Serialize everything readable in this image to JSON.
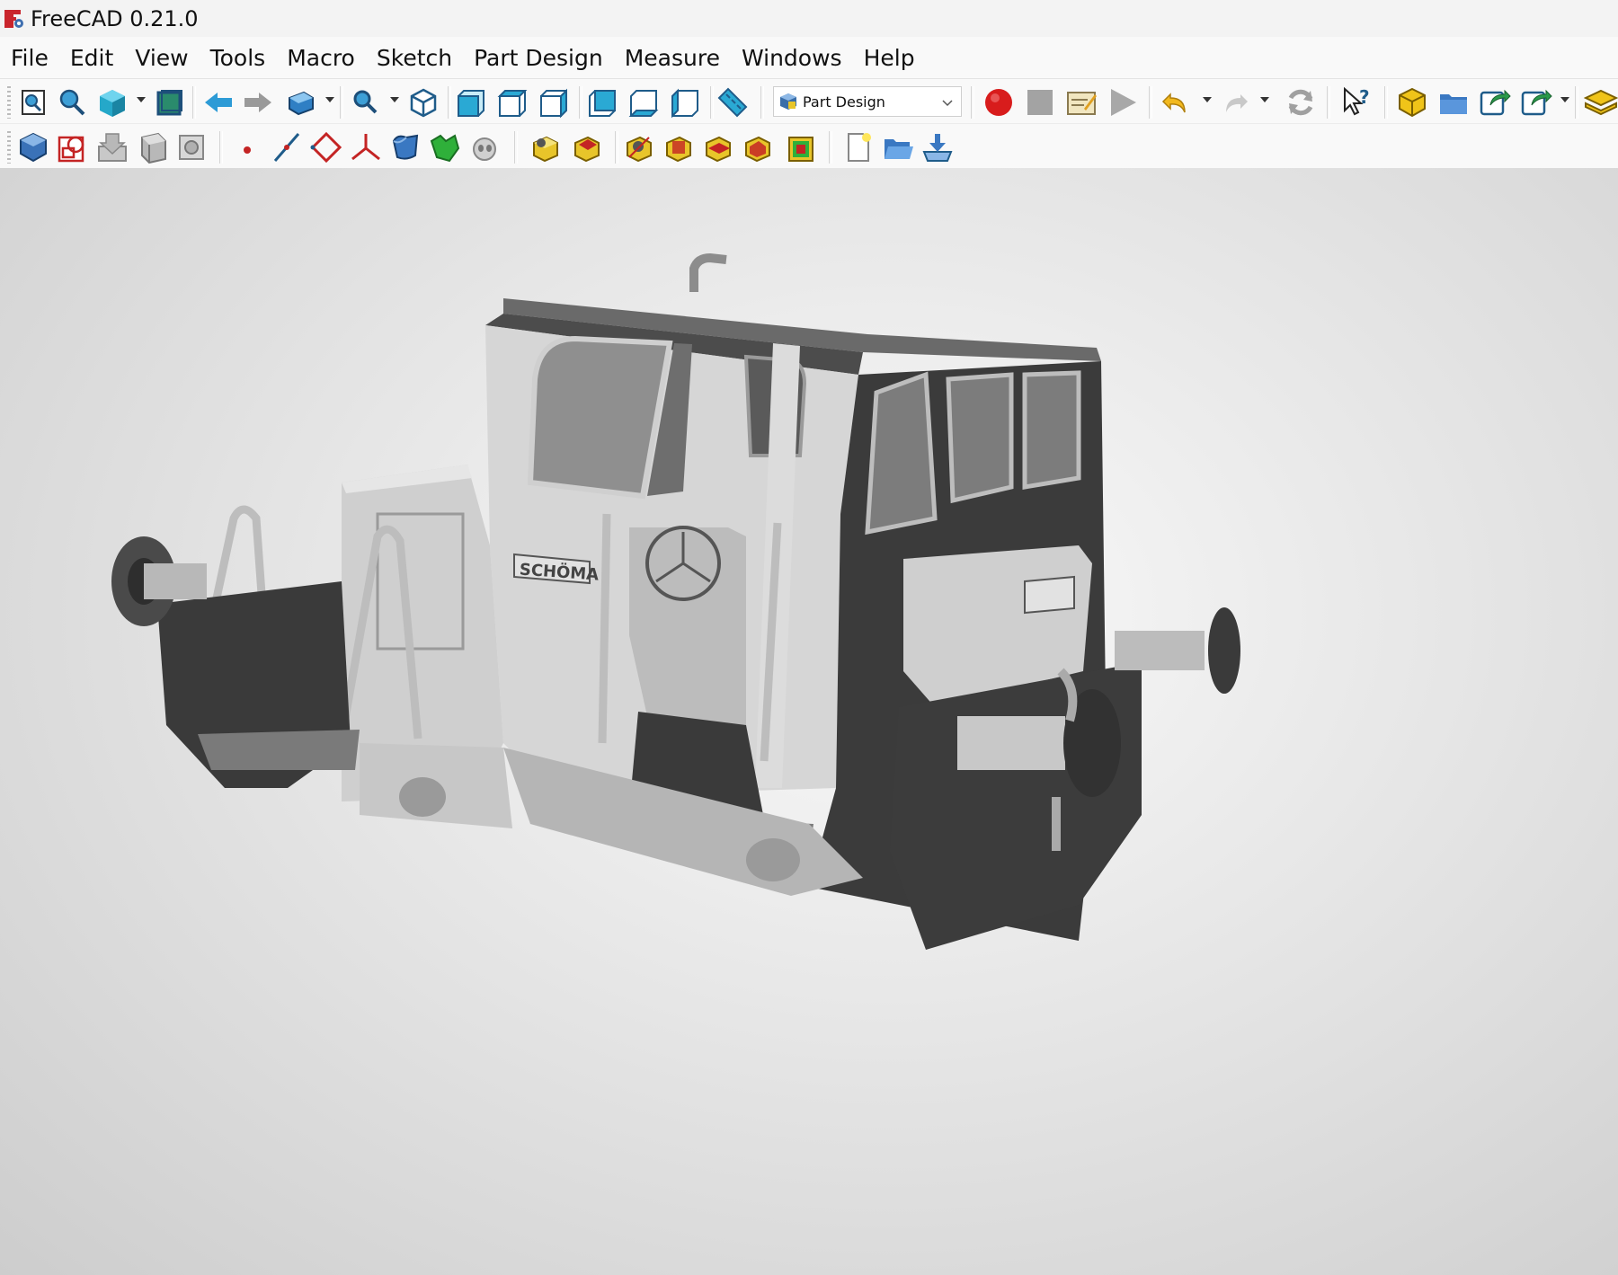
{
  "window": {
    "title": "FreeCAD 0.21.0",
    "logo_icon": "freecad-logo-icon"
  },
  "menu": [
    "File",
    "Edit",
    "View",
    "Tools",
    "Macro",
    "Sketch",
    "Part Design",
    "Measure",
    "Windows",
    "Help"
  ],
  "workbench_selector": {
    "value": "Part Design",
    "icon": "part-design-workbench-icon"
  },
  "toolbar_row1_icons": [
    "fit-all-icon",
    "fit-selection-icon",
    "std-view-menu-icon",
    "bounding-box-icon",
    "back-arrow-icon",
    "forward-arrow-icon",
    "draw-style-icon",
    "zoom-menu-icon",
    "isometric-view-icon",
    "front-view-icon",
    "top-view-icon",
    "right-view-icon",
    "rear-view-icon",
    "bottom-view-icon",
    "left-view-icon",
    "measure-distance-icon",
    "macro-record-icon",
    "macro-stop-icon",
    "macro-edit-icon",
    "macro-run-icon",
    "undo-icon",
    "redo-icon",
    "refresh-icon",
    "whats-this-icon",
    "part-icon",
    "group-icon",
    "link-icon",
    "link-actions-icon",
    "link-sub-icon"
  ],
  "toolbar_row2_icons": [
    "create-body-icon",
    "create-sketch-icon",
    "validate-sketch-icon",
    "check-geometry-icon",
    "shape-binder-icon",
    "datum-point-icon",
    "datum-line-icon",
    "datum-plane-icon",
    "local-coordinate-system-icon",
    "sub-shape-binder-icon",
    "clone-icon",
    "show-hide-icon",
    "pad-icon",
    "pocket-icon",
    "hole-icon",
    "revolution-icon",
    "groove-icon",
    "additive-loft-icon",
    "subtractive-loft-icon",
    "new-document-icon",
    "open-file-icon",
    "save-icon"
  ],
  "viewport": {
    "model": "locomotive-3d-model",
    "nameplate_text": "SCHÖMA"
  }
}
